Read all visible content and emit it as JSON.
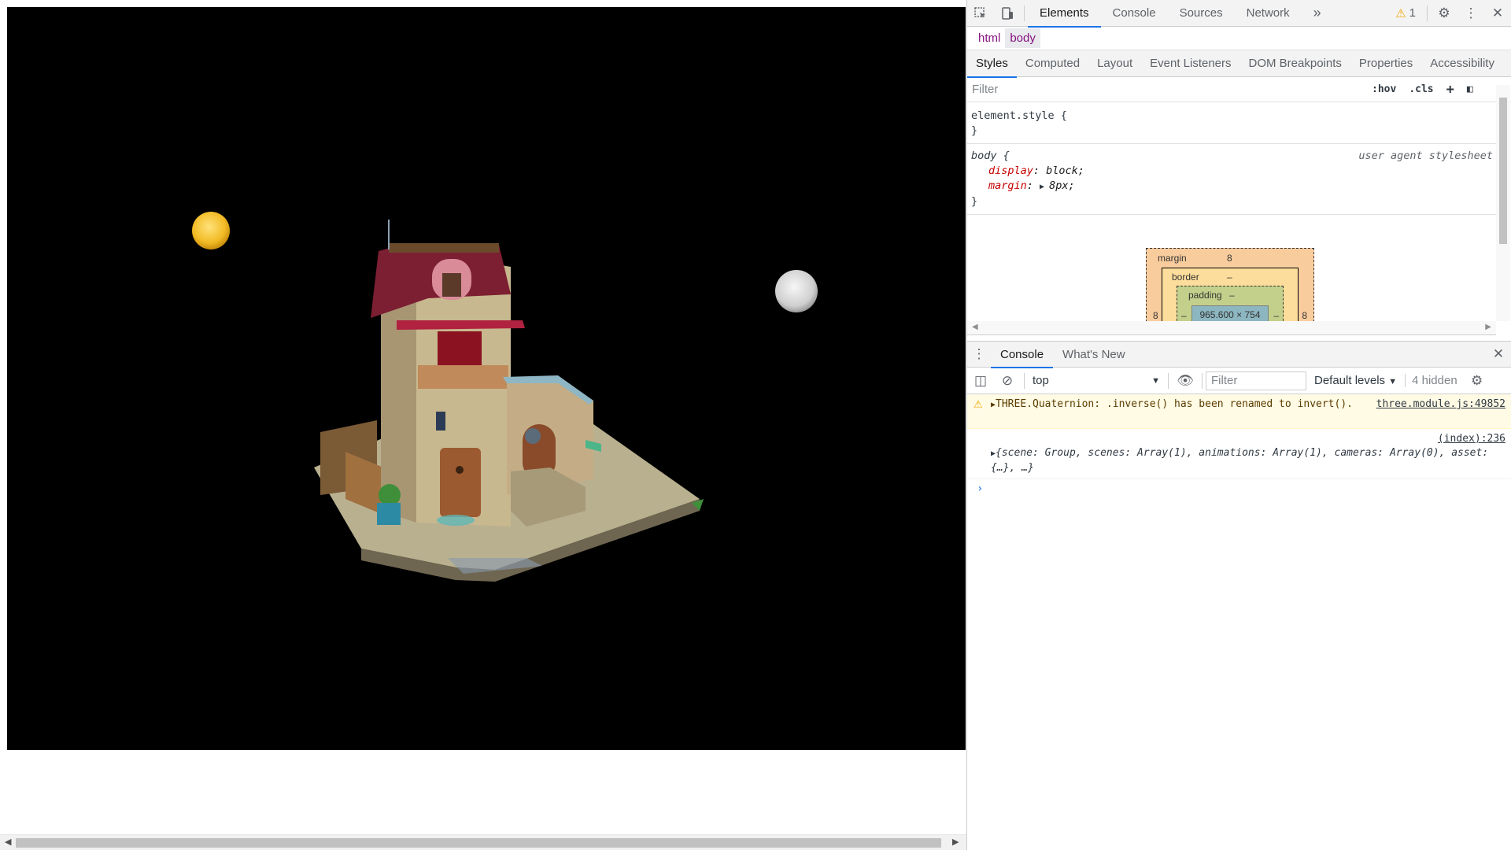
{
  "devtools": {
    "tabs": [
      "Elements",
      "Console",
      "Sources",
      "Network"
    ],
    "more_tabs": "»",
    "warning_count": "1",
    "breadcrumbs": [
      "html",
      "body"
    ],
    "subtabs": [
      "Styles",
      "Computed",
      "Layout",
      "Event Listeners",
      "DOM Breakpoints",
      "Properties",
      "Accessibility"
    ],
    "filter_placeholder": "Filter",
    "hov": ":hov",
    "cls": ".cls",
    "element_style_open": "element.style {",
    "close_brace": "}",
    "body_rule_selector": "body {",
    "ua_stylesheet": "user agent stylesheet",
    "props": [
      {
        "name": "display",
        "value": "block;"
      },
      {
        "name": "margin",
        "value": "8px;"
      }
    ],
    "box_model": {
      "margin_label": "margin",
      "margin_value": "8",
      "border_label": "border",
      "border_value": "–",
      "padding_label": "padding",
      "padding_value": "–",
      "content_size": "965.600 × 754",
      "left_margin": "8",
      "right_margin": "8",
      "dash": "–"
    },
    "drawer_tabs": [
      "Console",
      "What's New"
    ],
    "console": {
      "context": "top",
      "filter_placeholder": "Filter",
      "levels": "Default levels",
      "hidden": "4 hidden",
      "warning_text": "THREE.Quaternion: .inverse() has been renamed to invert().",
      "warning_src": "three.module.js:49852",
      "log_src": "(index):236",
      "log_text": "{scene: Group, scenes: Array(1), animations: Array(1), cameras: Array(0), asset: {…}, …}",
      "prompt": "›"
    }
  },
  "colors": {
    "accent": "#1a73e8",
    "canvas_bg": "#000000",
    "sun": "#f5c42c",
    "moon": "#e2e2e2"
  }
}
